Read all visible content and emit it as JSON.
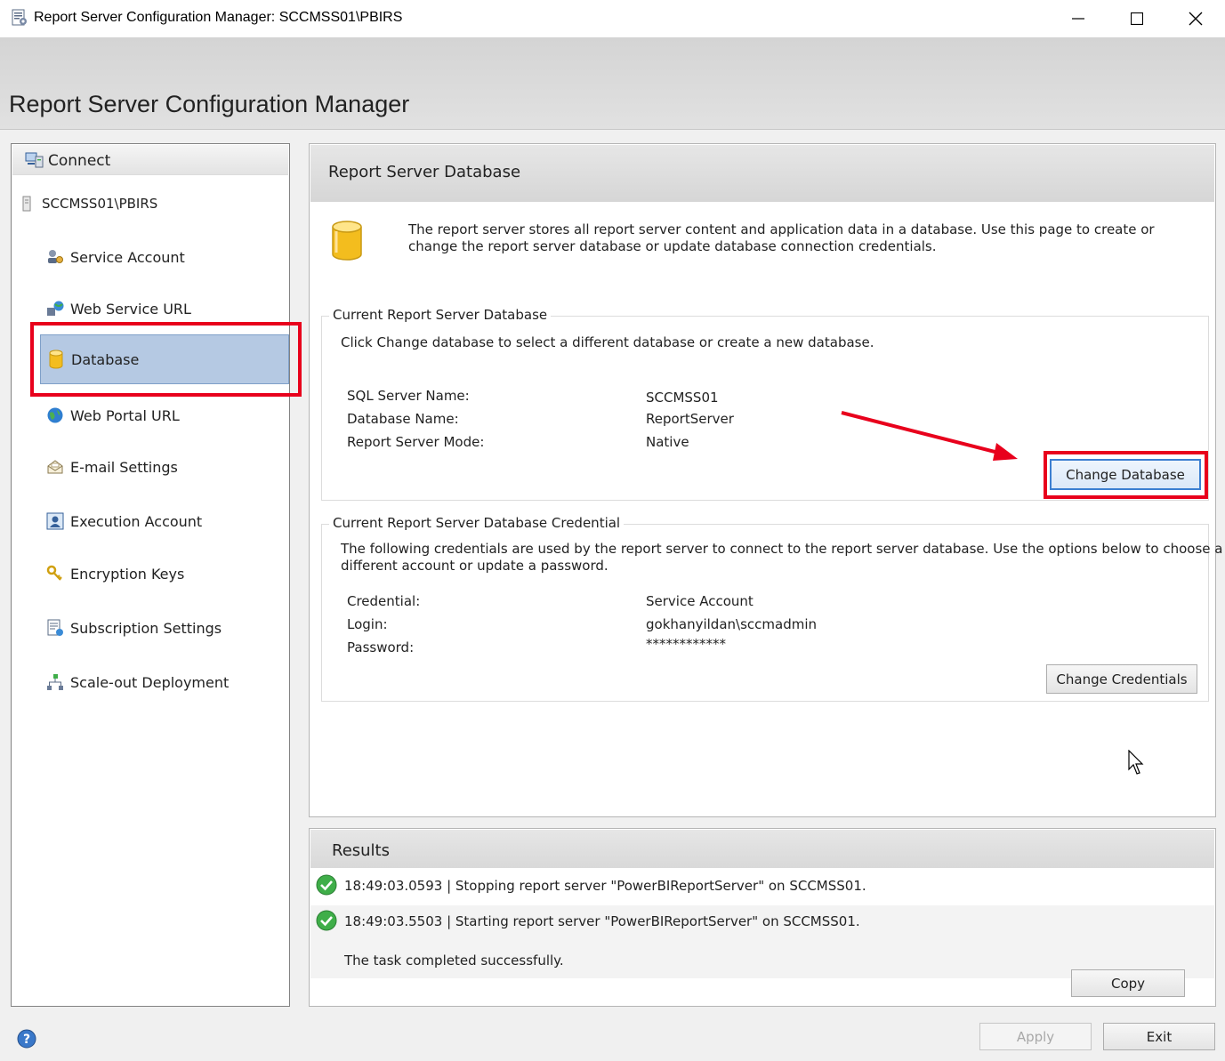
{
  "window": {
    "title": "Report Server Configuration Manager: SCCMSS01\\PBIRS",
    "controls": [
      "minimize",
      "maximize",
      "close"
    ]
  },
  "banner": {
    "title": "Report Server Configuration Manager"
  },
  "nav": {
    "connect_label": "Connect",
    "server_label": "SCCMSS01\\PBIRS",
    "items": [
      {
        "label": "Service Account",
        "icon": "service-account-icon"
      },
      {
        "label": "Web Service URL",
        "icon": "web-service-icon"
      },
      {
        "label": "Database",
        "icon": "database-icon",
        "selected": true
      },
      {
        "label": "Web Portal URL",
        "icon": "globe-icon"
      },
      {
        "label": "E-mail Settings",
        "icon": "email-icon"
      },
      {
        "label": "Execution Account",
        "icon": "execution-account-icon"
      },
      {
        "label": "Encryption Keys",
        "icon": "keys-icon"
      },
      {
        "label": "Subscription Settings",
        "icon": "subscription-icon"
      },
      {
        "label": "Scale-out Deployment",
        "icon": "scaleout-icon"
      }
    ]
  },
  "main": {
    "title": "Report Server Database",
    "intro_line1": "The report server stores all report server content and application data in a database. Use this page to create or",
    "intro_line2": "change the report server database or update database connection credentials.",
    "current_db": {
      "legend": "Current Report Server Database",
      "hint": "Click Change database to select a different database or create a new database.",
      "sql_server_label": "SQL Server Name:",
      "sql_server_value": "SCCMSS01",
      "db_name_label": "Database Name:",
      "db_name_value": "ReportServer",
      "mode_label": "Report Server Mode:",
      "mode_value": "Native",
      "change_button": "Change Database"
    },
    "credential": {
      "legend": "Current Report Server Database Credential",
      "hint_line1": "The following credentials are used by the report server to connect to the report server database.  Use the options below to choose a",
      "hint_line2": "different account or update a password.",
      "credential_label": "Credential:",
      "credential_value": "Service Account",
      "login_label": "Login:",
      "login_value": "gokhanyildan\\sccmadmin",
      "password_label": "Password:",
      "password_value": "************",
      "change_button": "Change Credentials"
    }
  },
  "results": {
    "title": "Results",
    "rows": [
      {
        "status": "success",
        "text": "18:49:03.0593 | Stopping report server \"PowerBIReportServer\" on SCCMSS01."
      },
      {
        "status": "success",
        "text": "18:49:03.5503 | Starting report server \"PowerBIReportServer\" on SCCMSS01."
      }
    ],
    "summary": "The task completed successfully.",
    "copy_button": "Copy"
  },
  "footer": {
    "apply_button": "Apply",
    "exit_button": "Exit"
  },
  "colors": {
    "selection": "#b5c9e3",
    "highlight": "#e8001c",
    "accent": "#3c7fd1",
    "success": "#3fae49"
  }
}
